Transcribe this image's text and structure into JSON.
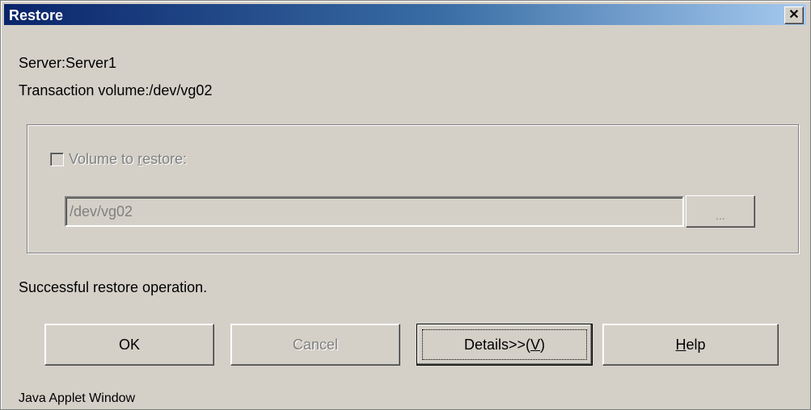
{
  "window": {
    "title": "Restore",
    "close_glyph": "✕"
  },
  "info": {
    "server": "Server:Server1",
    "transaction_volume": "Transaction volume:/dev/vg02"
  },
  "restore_group": {
    "checkbox_label_pre": "Volume to ",
    "checkbox_label_mnemonic": "r",
    "checkbox_label_post": "estore:",
    "checked": false,
    "enabled": false,
    "volume_value": "/dev/vg02",
    "browse_label": "..."
  },
  "status": "Successful restore operation.",
  "buttons": {
    "ok": "OK",
    "cancel": "Cancel",
    "details_pre": "Details>>(",
    "details_mnemonic": "V",
    "details_post": ")",
    "help_mnemonic": "H",
    "help_post": "elp"
  },
  "footer": "Java Applet Window",
  "colors": {
    "title_start": "#0a246a",
    "title_end": "#a6caf0",
    "face": "#d4d0c8",
    "disabled_text": "#808080"
  }
}
